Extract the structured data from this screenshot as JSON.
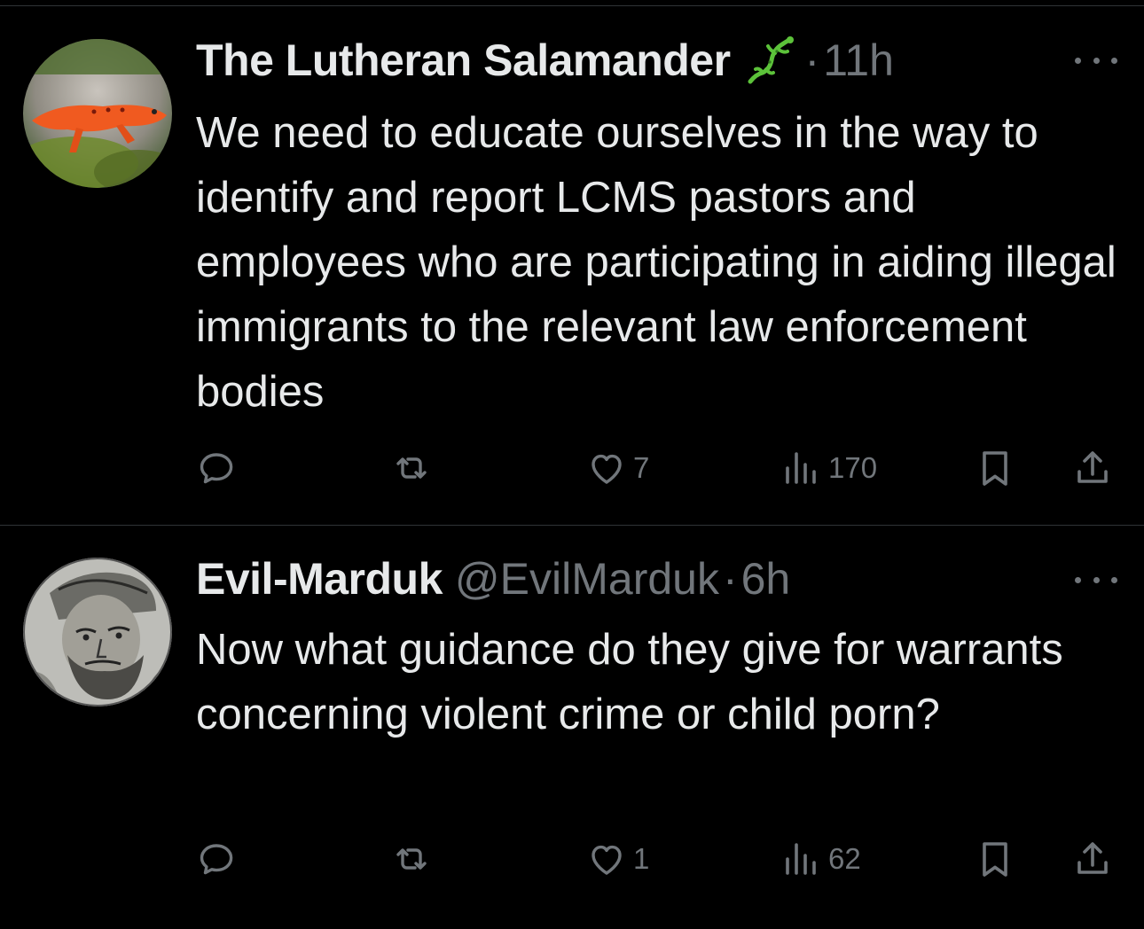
{
  "tweets": [
    {
      "name": "The Lutheran Salamander",
      "handle": "",
      "separator": "·",
      "time": "11h",
      "emoji_icon": "lizard-icon",
      "text": "We need to educate ourselves in the way to identify and report LCMS pastors and employees who are participating in aiding illegal immigrants to the relevant law enforcement bodies",
      "replies": "",
      "reposts": "",
      "likes": "7",
      "views": "170"
    },
    {
      "name": "Evil-Marduk",
      "handle": "@EvilMarduk",
      "separator": "·",
      "time": "6h",
      "emoji_icon": "",
      "text": "Now what guidance do they give for warrants concerning violent crime or child porn?",
      "replies": "",
      "reposts": "",
      "likes": "1",
      "views": "62"
    }
  ],
  "icons": {
    "reply": "reply-icon",
    "repost": "repost-icon",
    "like": "heart-icon",
    "views": "views-icon",
    "bookmark": "bookmark-icon",
    "share": "share-icon",
    "more": "more-icon"
  },
  "colors": {
    "background": "#000000",
    "text": "#e7e9ea",
    "muted": "#71767b",
    "divider": "#2f3336"
  }
}
